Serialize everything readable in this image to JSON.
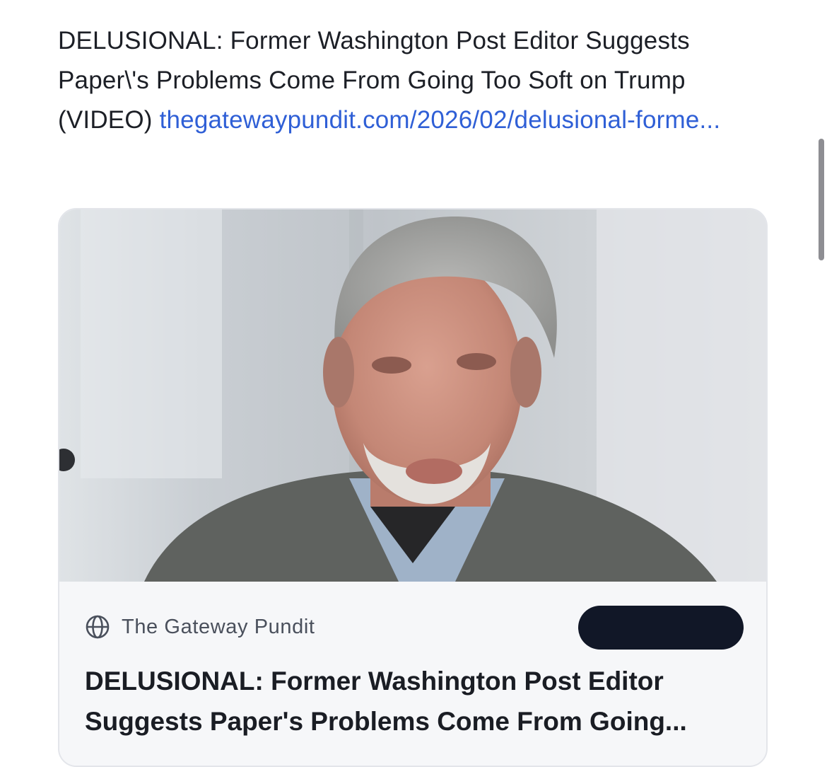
{
  "post": {
    "text": "DELUSIONAL: Former Washington Post Editor Suggests Paper\\'s Problems Come From Going Too Soft on Trump (VIDEO) ",
    "link_text": "thegatewaypundit.com/2026/02/delusional-forme..."
  },
  "card": {
    "image_description_icon": "person-photo",
    "source_icon": "globe-icon",
    "source_name": "The Gateway Pundit",
    "button_label": "",
    "title": "DELUSIONAL: Former Washington Post Editor Suggests Paper's Problems Come From Going..."
  },
  "colors": {
    "link": "#2f5fd6",
    "text": "#1c1f26",
    "button": "#111727",
    "card_bg": "#f6f7f9"
  }
}
